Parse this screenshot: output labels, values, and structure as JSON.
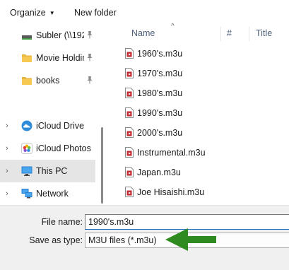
{
  "toolbar": {
    "organize_label": "Organize",
    "new_folder_label": "New folder"
  },
  "nav": {
    "items": [
      {
        "label": "Subler (\\\\192",
        "icon": "network-drive-icon",
        "pinned": true
      },
      {
        "label": "Movie Holdir",
        "icon": "folder-icon",
        "pinned": true
      },
      {
        "label": "books",
        "icon": "folder-icon",
        "pinned": true
      },
      {
        "label": "iCloud Drive",
        "icon": "icloud-drive-icon",
        "pinned": false
      },
      {
        "label": "iCloud Photos",
        "icon": "icloud-photos-icon",
        "pinned": false
      },
      {
        "label": "This PC",
        "icon": "this-pc-icon",
        "pinned": false,
        "selected": true
      },
      {
        "label": "Network",
        "icon": "network-icon",
        "pinned": false
      }
    ]
  },
  "columns": {
    "name": "Name",
    "number": "#",
    "title": "Title"
  },
  "files": [
    {
      "name": "1960's.m3u"
    },
    {
      "name": "1970's.m3u"
    },
    {
      "name": "1980's.m3u"
    },
    {
      "name": "1990's.m3u"
    },
    {
      "name": "2000's.m3u"
    },
    {
      "name": "Instrumental.m3u"
    },
    {
      "name": "Japan.m3u"
    },
    {
      "name": "Joe Hisaishi.m3u"
    }
  ],
  "save": {
    "file_name_label": "File name:",
    "file_name_value": "1990's.m3u",
    "save_as_type_label": "Save as type:",
    "save_as_type_value": "M3U files (*.m3u)"
  },
  "colors": {
    "accent": "#1a6fbf",
    "folder": "#f2c14e",
    "selected_bg": "#e5e5e5",
    "annotation_arrow": "#2f8a1f",
    "file_icon_red": "#c1272d"
  }
}
